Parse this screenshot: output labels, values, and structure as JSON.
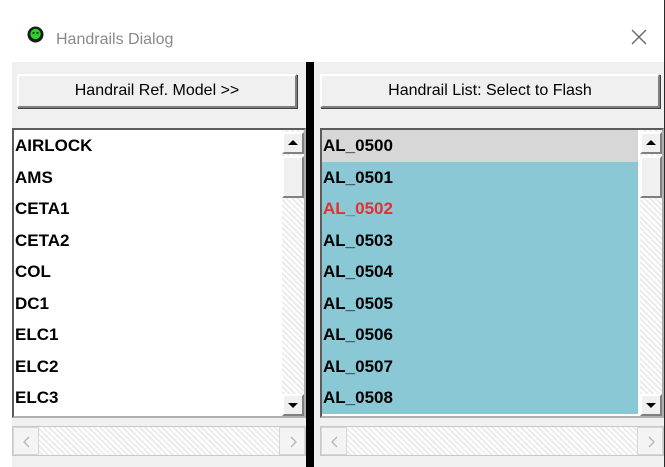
{
  "window": {
    "title": "Handrails Dialog",
    "icon": "green-face-icon",
    "close_icon": "close-icon"
  },
  "left_panel": {
    "header_label": "Handrail Ref. Model >>",
    "items": [
      "AIRLOCK",
      "AMS",
      "CETA1",
      "CETA2",
      "COL",
      "DC1",
      "ELC1",
      "ELC2",
      "ELC3"
    ]
  },
  "right_panel": {
    "header_label": "Handrail List: Select to Flash",
    "items": [
      "AL_0500",
      "AL_0501",
      "AL_0502",
      "AL_0503",
      "AL_0504",
      "AL_0505",
      "AL_0506",
      "AL_0507",
      "AL_0508"
    ],
    "selected_item": "AL_0500",
    "flashing_item": "AL_0502"
  },
  "colors": {
    "list_highlight": "#8bc8d6",
    "selected_row": "#d7d7d7",
    "flash_text": "#e53030",
    "title_text": "#8a8a8a"
  }
}
